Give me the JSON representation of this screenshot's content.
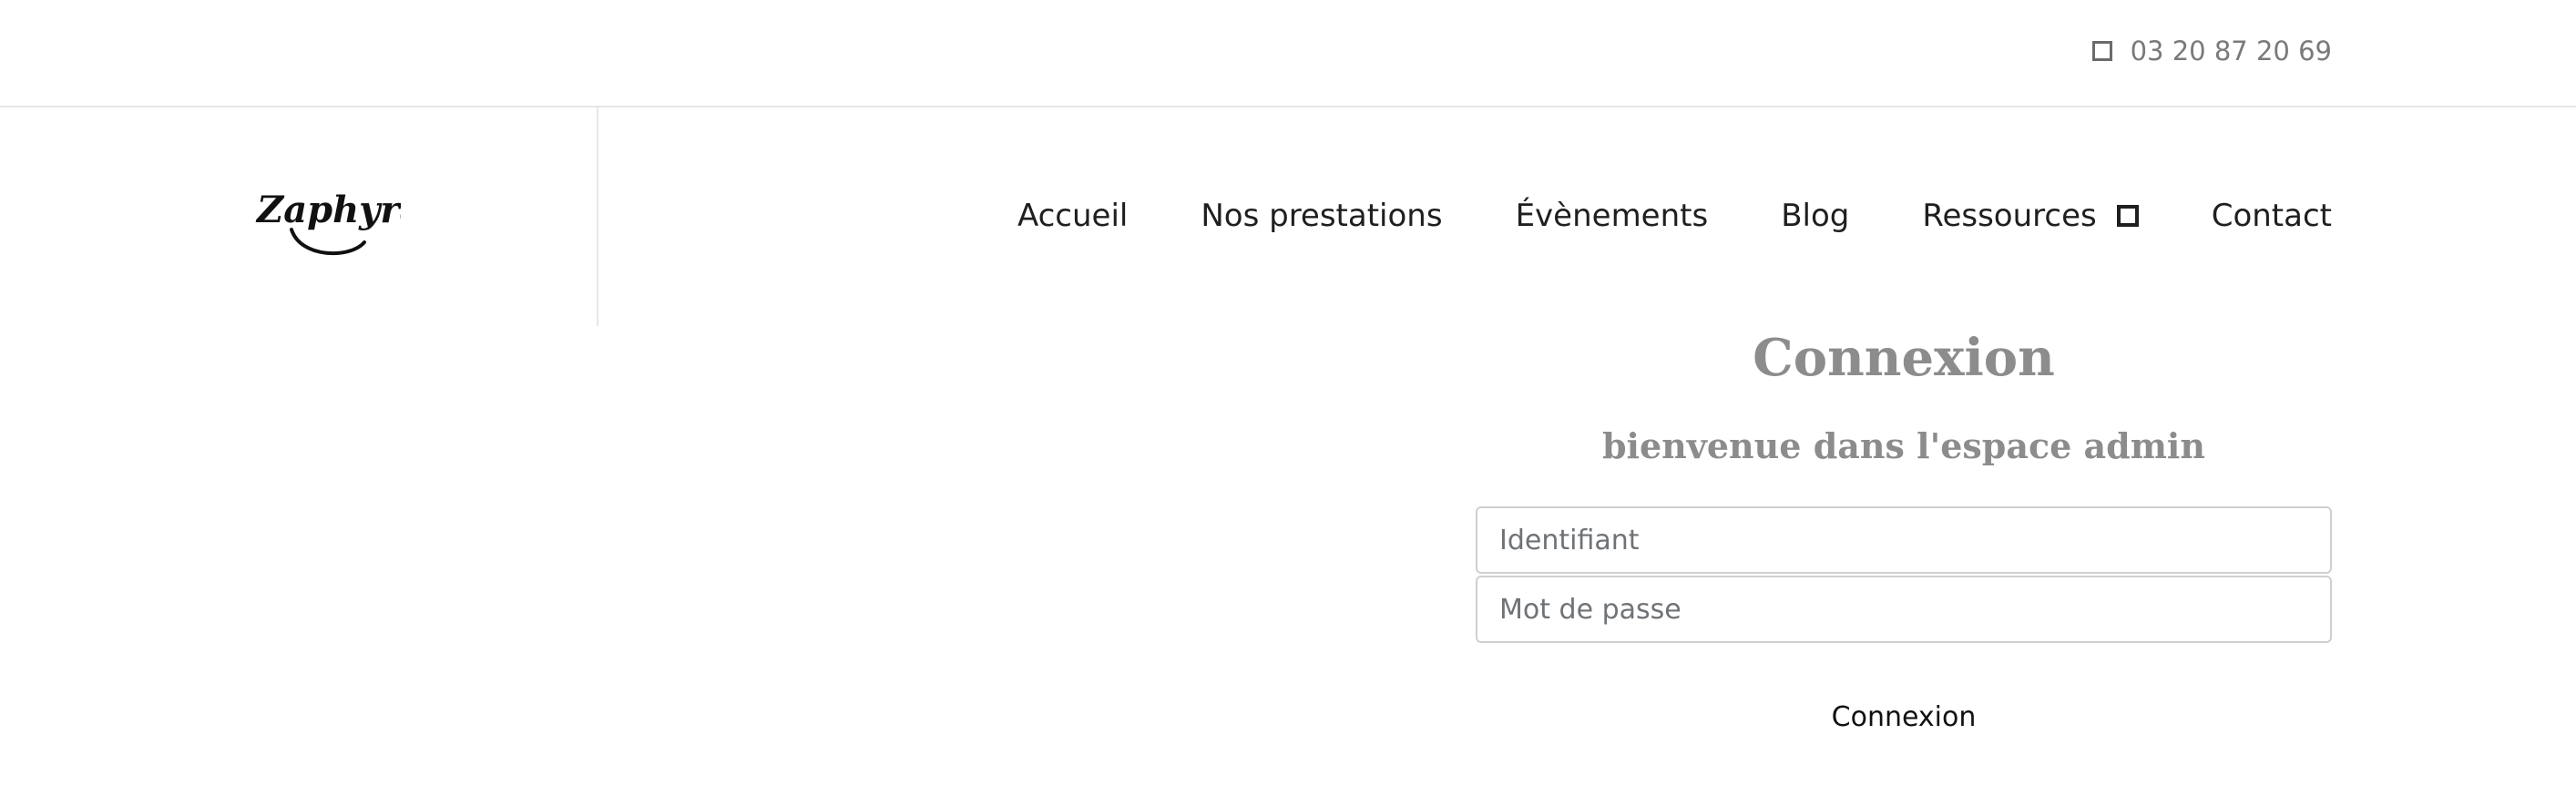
{
  "topbar": {
    "phone_icon": "square-icon",
    "phone": "03 20 87 20 69"
  },
  "logo": {
    "text": "Zaphyra"
  },
  "nav": {
    "items": [
      {
        "label": "Accueil"
      },
      {
        "label": "Nos prestations"
      },
      {
        "label": "Évènements"
      },
      {
        "label": "Blog"
      },
      {
        "label": "Ressources",
        "icon": "dropdown-square-icon"
      },
      {
        "label": "Contact"
      }
    ]
  },
  "login": {
    "title": "Connexion",
    "subtitle": "bienvenue dans l'espace admin",
    "username_placeholder": "Identifiant",
    "username_value": "",
    "password_placeholder": "Mot de passe",
    "password_value": "",
    "submit_label": "Connexion"
  }
}
